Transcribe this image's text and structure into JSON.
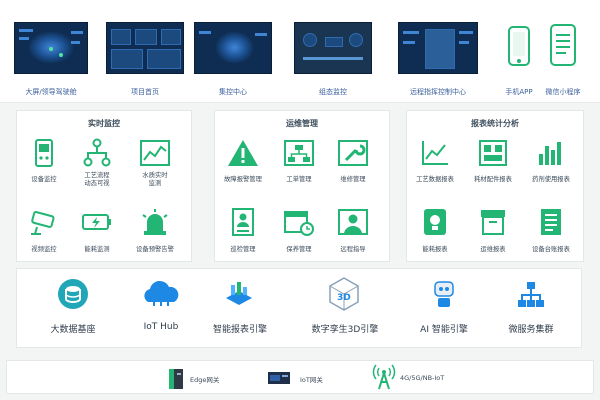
{
  "top_items": [
    {
      "label": "大屏/领导驾驶舱",
      "icon": "dashboard-map-thumbnail"
    },
    {
      "label": "项目首页",
      "icon": "project-dashboard-thumbnail"
    },
    {
      "label": "集控中心",
      "icon": "control-center-map-thumbnail"
    },
    {
      "label": "组态监控",
      "icon": "scada-thumbnail"
    },
    {
      "label": "远程指挥控制中心",
      "icon": "command-center-thumbnail"
    },
    {
      "label": "手机APP",
      "icon": "mobile-app-icon"
    },
    {
      "label": "微信小程序",
      "icon": "wechat-miniprogram-icon"
    }
  ],
  "panels": [
    {
      "title": "实时监控",
      "items": [
        {
          "label": "设备监控",
          "icon": "device-monitor-icon"
        },
        {
          "label": "工艺流程\n动态可视",
          "icon": "process-flow-icon"
        },
        {
          "label": "水质实时\n监测",
          "icon": "water-quality-chart-icon"
        },
        {
          "label": "视频监控",
          "icon": "camera-icon"
        },
        {
          "label": "能耗监测",
          "icon": "battery-icon"
        },
        {
          "label": "设备预警告警",
          "icon": "alarm-light-icon"
        }
      ]
    },
    {
      "title": "运维管理",
      "items": [
        {
          "label": "故障报警管理",
          "icon": "warning-icon"
        },
        {
          "label": "工单管理",
          "icon": "org-chart-icon"
        },
        {
          "label": "维修管理",
          "icon": "wrench-icon"
        },
        {
          "label": "巡检管理",
          "icon": "inspection-card-icon"
        },
        {
          "label": "保养管理",
          "icon": "maintenance-calendar-icon"
        },
        {
          "label": "远程指导",
          "icon": "remote-guide-person-icon"
        }
      ]
    },
    {
      "title": "报表统计分析",
      "items": [
        {
          "label": "工艺数据报表",
          "icon": "line-chart-icon"
        },
        {
          "label": "耗材配件报表",
          "icon": "parts-board-icon"
        },
        {
          "label": "药剂使用报表",
          "icon": "bar-chart-icon"
        },
        {
          "label": "能耗报表",
          "icon": "bulb-icon"
        },
        {
          "label": "运维报表",
          "icon": "archive-box-icon"
        },
        {
          "label": "设备台账报表",
          "icon": "ledger-document-icon"
        }
      ]
    }
  ],
  "platform": [
    {
      "label": "大数据基座",
      "icon": "database-icon"
    },
    {
      "label": "IoT Hub",
      "icon": "cloud-network-icon"
    },
    {
      "label": "智能报表引擎",
      "icon": "report-engine-icon"
    },
    {
      "label": "数字孪生3D引擎",
      "icon": "3d-cube-icon"
    },
    {
      "label": "AI 智能引擎",
      "icon": "ai-robot-icon"
    },
    {
      "label": "微服务集群",
      "icon": "microservice-cluster-icon"
    }
  ],
  "bottom": [
    {
      "label": "Edge网关",
      "icon": "edge-gateway-icon"
    },
    {
      "label": "IoT网关",
      "icon": "iot-gateway-icon"
    },
    {
      "label": "4G/5G/NB-IoT",
      "icon": "antenna-icon"
    }
  ],
  "colors": {
    "accent": "#22b573",
    "caption": "#3b5e9c",
    "thumb_bg": "#0f2d52",
    "platform_icon": "#1e88e5"
  }
}
